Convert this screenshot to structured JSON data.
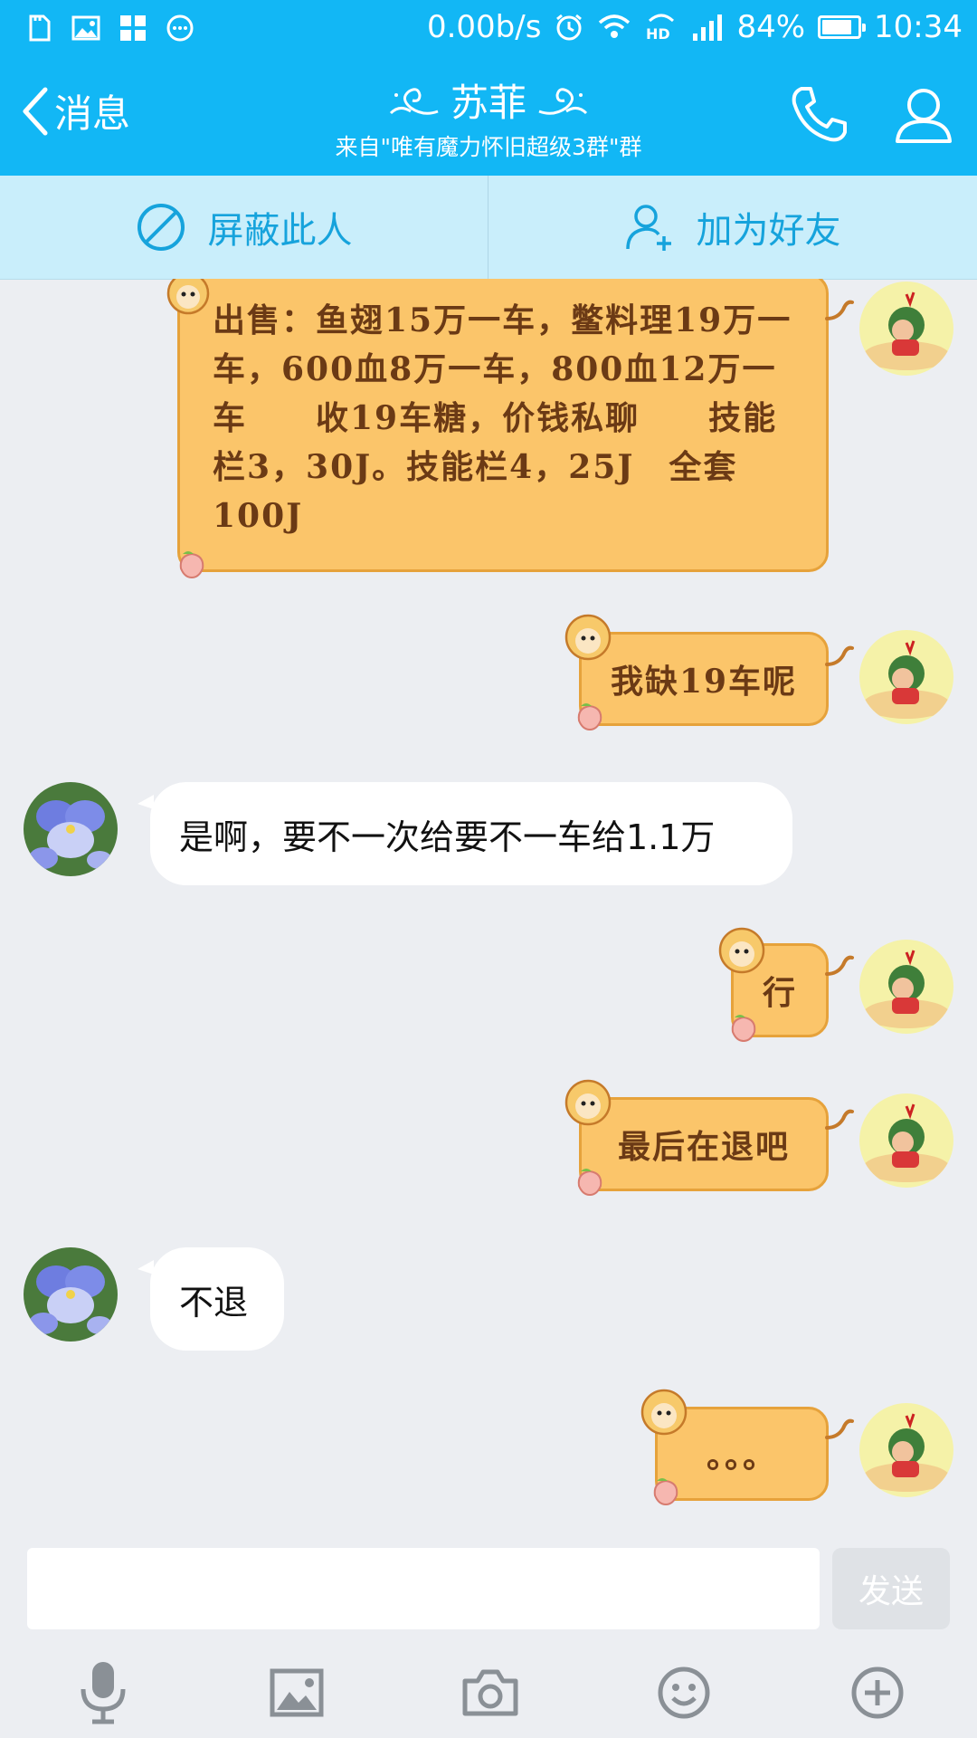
{
  "status_bar": {
    "network_speed": "0.00b/s",
    "battery": "84%",
    "battery_level": 0.84,
    "time": "10:34"
  },
  "header": {
    "back_label": "消息",
    "contact_name": "苏菲",
    "subtitle": "来自\"唯有魔力怀旧超级3群\"群"
  },
  "actions": {
    "block_label": "屏蔽此人",
    "add_friend_label": "加为好友"
  },
  "messages": [
    {
      "side": "right",
      "style": "orange",
      "text": "出售：鱼翅15万一车，鳖料理19万一车，600血8万一车，800血12万一车　　收19车糖，价钱私聊　　技能栏3，30J。技能栏4，25J　全套100J"
    },
    {
      "side": "right",
      "style": "orange",
      "text": "我缺19车呢"
    },
    {
      "side": "left",
      "style": "white",
      "text": "是啊，要不一次给要不一车给1.1万"
    },
    {
      "side": "right",
      "style": "orange",
      "text": "行"
    },
    {
      "side": "right",
      "style": "orange",
      "text": "最后在退吧"
    },
    {
      "side": "left",
      "style": "white",
      "text": "不退"
    },
    {
      "side": "right",
      "style": "orange",
      "text": "。。。"
    }
  ],
  "input": {
    "value": "",
    "placeholder": "",
    "send_label": "发送"
  },
  "toolbar": {
    "items": [
      "microphone-icon",
      "image-icon",
      "camera-icon",
      "emoji-icon",
      "plus-icon"
    ]
  },
  "colors": {
    "header_bg": "#12b7f5",
    "action_bar_bg": "#c9eefb",
    "bubble_orange": "#fbc56a",
    "chat_bg": "#eceef2"
  }
}
